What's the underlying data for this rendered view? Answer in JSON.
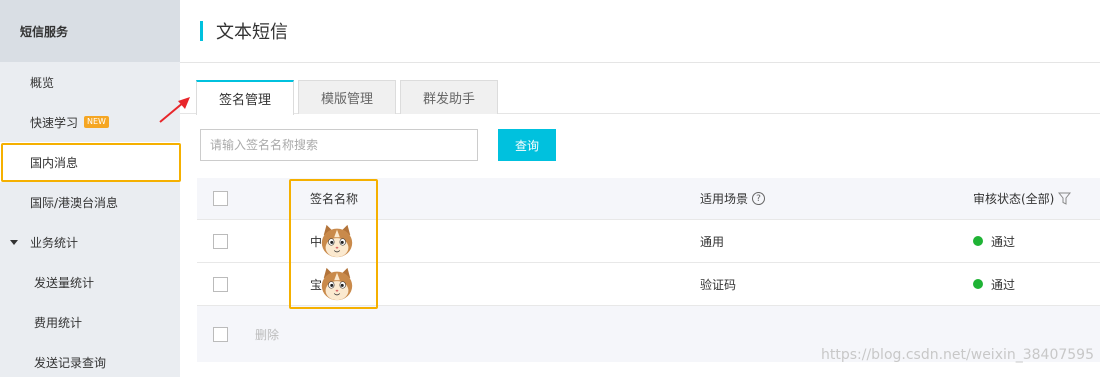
{
  "sidebar": {
    "header": "短信服务",
    "items": [
      {
        "label": "概览"
      },
      {
        "label": "快速学习",
        "badge": "NEW"
      },
      {
        "label": "国内消息"
      },
      {
        "label": "国际/港澳台消息"
      },
      {
        "label": "业务统计"
      },
      {
        "label": "发送量统计"
      },
      {
        "label": "费用统计"
      },
      {
        "label": "发送记录查询"
      }
    ]
  },
  "header": {
    "title": "文本短信"
  },
  "tabs": [
    {
      "label": "签名管理"
    },
    {
      "label": "模版管理"
    },
    {
      "label": "群发助手"
    }
  ],
  "search": {
    "placeholder": "请输入签名名称搜索",
    "button": "查询"
  },
  "table": {
    "columns": {
      "name": "签名名称",
      "scene": "适用场景",
      "status": "审核状态(全部)"
    },
    "rows": [
      {
        "name": "中",
        "scene": "通用",
        "status": "通过"
      },
      {
        "name": "宝",
        "scene": "验证码",
        "status": "通过"
      }
    ],
    "delete_label": "删除"
  },
  "help_glyph": "?",
  "watermark": "https://blog.csdn.net/weixin_38407595",
  "colors": {
    "accent": "#00c1de",
    "highlight": "#f5b000",
    "status_ok": "#1fb335",
    "arrow": "#e8262b"
  }
}
